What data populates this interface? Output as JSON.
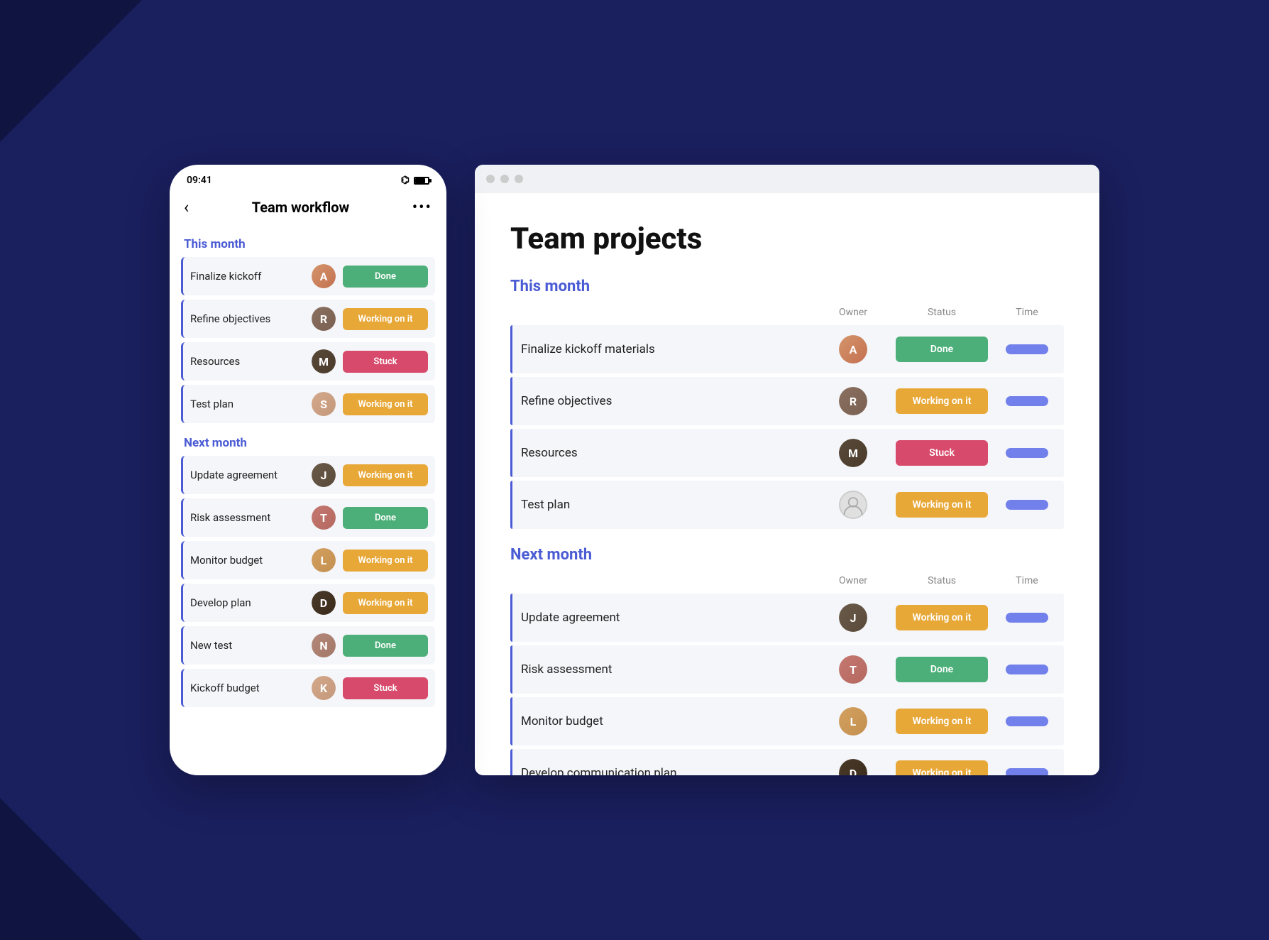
{
  "background": {
    "color": "#1a1f5e"
  },
  "mobile": {
    "status_bar": {
      "time": "09:41"
    },
    "header": {
      "back_label": "‹",
      "title": "Team workflow",
      "menu_label": "•••"
    },
    "this_month_label": "This month",
    "this_month_tasks": [
      {
        "name": "Finalize kickoff",
        "avatar_class": "av1",
        "avatar_initial": "A",
        "status": "Done",
        "status_class": "status-done"
      },
      {
        "name": "Refine objectives",
        "avatar_class": "av2",
        "avatar_initial": "R",
        "status": "Working on it",
        "status_class": "status-working"
      },
      {
        "name": "Resources",
        "avatar_class": "av3",
        "avatar_initial": "M",
        "status": "Stuck",
        "status_class": "status-stuck"
      },
      {
        "name": "Test plan",
        "avatar_class": "av4",
        "avatar_initial": "S",
        "status": "Working on it",
        "status_class": "status-working"
      }
    ],
    "next_month_label": "Next month",
    "next_month_tasks": [
      {
        "name": "Update agreement",
        "avatar_class": "av5",
        "avatar_initial": "J",
        "status": "Working on it",
        "status_class": "status-working"
      },
      {
        "name": "Risk assessment",
        "avatar_class": "av6",
        "avatar_initial": "T",
        "status": "Done",
        "status_class": "status-done"
      },
      {
        "name": "Monitor budget",
        "avatar_class": "av7",
        "avatar_initial": "L",
        "status": "Working on it",
        "status_class": "status-working"
      },
      {
        "name": "Develop plan",
        "avatar_class": "av8",
        "avatar_initial": "D",
        "status": "Working on it",
        "status_class": "status-working"
      },
      {
        "name": "New test",
        "avatar_class": "av9",
        "avatar_initial": "N",
        "status": "Done",
        "status_class": "status-done"
      },
      {
        "name": "Kickoff budget",
        "avatar_class": "av4",
        "avatar_initial": "K",
        "status": "Stuck",
        "status_class": "status-stuck"
      }
    ]
  },
  "desktop": {
    "page_title": "Team projects",
    "this_month_label": "This month",
    "col_owner": "Owner",
    "col_status": "Status",
    "col_time": "Time",
    "this_month_tasks": [
      {
        "name": "Finalize kickoff materials",
        "avatar_class": "av1",
        "avatar_initial": "A",
        "status": "Done",
        "status_class": "status-done"
      },
      {
        "name": "Refine objectives",
        "avatar_class": "av2",
        "avatar_initial": "R",
        "status": "Working on it",
        "status_class": "status-working"
      },
      {
        "name": "Resources",
        "avatar_class": "av3",
        "avatar_initial": "M",
        "status": "Stuck",
        "status_class": "status-stuck"
      },
      {
        "name": "Test plan",
        "avatar_class": "av-empty",
        "avatar_initial": "",
        "status": "Working on it",
        "status_class": "status-working"
      }
    ],
    "next_month_label": "Next month",
    "next_month_tasks": [
      {
        "name": "Update agreement",
        "avatar_class": "av5",
        "avatar_initial": "J",
        "status": "Working on it",
        "status_class": "status-working"
      },
      {
        "name": "Risk assessment",
        "avatar_class": "av6",
        "avatar_initial": "T",
        "status": "Done",
        "status_class": "status-done"
      },
      {
        "name": "Monitor budget",
        "avatar_class": "av7",
        "avatar_initial": "L",
        "status": "Working on it",
        "status_class": "status-working"
      },
      {
        "name": "Develop communication plan",
        "avatar_class": "av8",
        "avatar_initial": "D",
        "status": "Working on it",
        "status_class": "status-working"
      }
    ]
  }
}
